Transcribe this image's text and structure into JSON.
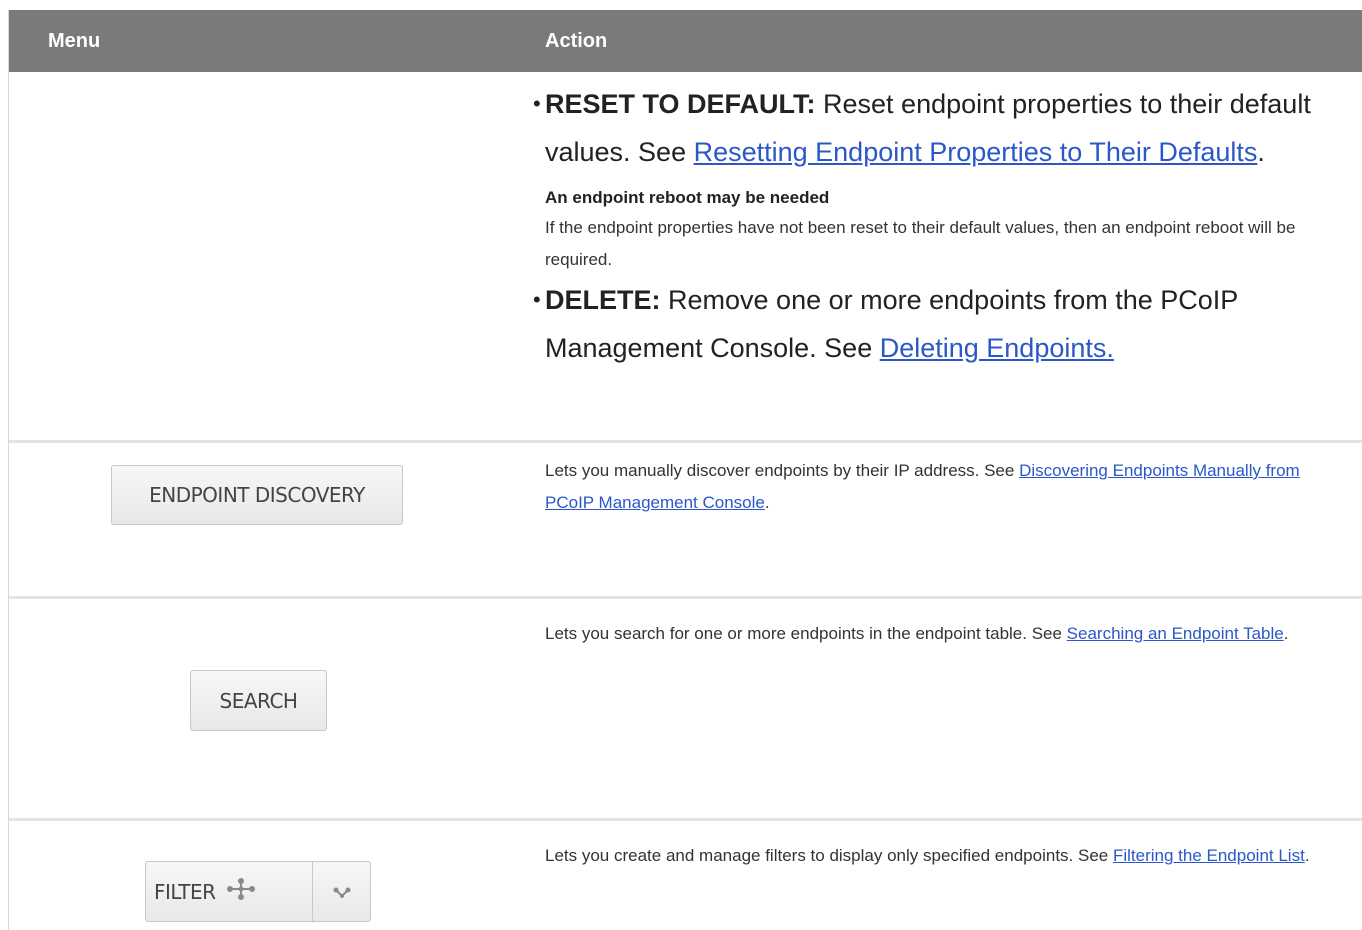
{
  "header": {
    "menu": "Menu",
    "action": "Action"
  },
  "rows": [
    {
      "items": [
        {
          "bullet": "•",
          "label": "RESET TO DEFAULT:",
          "text": " Reset endpoint properties to their default values. See ",
          "link": "Resetting Endpoint Properties to Their Defaults",
          "after": "."
        },
        {
          "bullet": "•",
          "label": "DELETE:",
          "text": " Remove one or more endpoints from the PCoIP Management Console. See ",
          "link": "Deleting Endpoints.",
          "after": ""
        }
      ],
      "note_title": "An endpoint reboot may be needed",
      "note_body": "If the endpoint properties have not been reset to their default values, then an endpoint reboot will be required."
    },
    {
      "button": "ENDPOINT DISCOVERY",
      "text": "Lets you manually discover endpoints by their IP address. See ",
      "link": "Discovering Endpoints Manually from PCoIP Management Console",
      "after": "."
    },
    {
      "button": "SEARCH",
      "text": "Lets you search for one or more endpoints in the endpoint table. See ",
      "link": "Searching an Endpoint Table",
      "after": "."
    },
    {
      "button": "FILTER",
      "button_icon": "move-arrows-icon",
      "caret_icon": "chevron-down-icon",
      "text": "Lets you create and manage filters to display only specified endpoints. See ",
      "link": "Filtering the Endpoint List",
      "after": "."
    }
  ]
}
